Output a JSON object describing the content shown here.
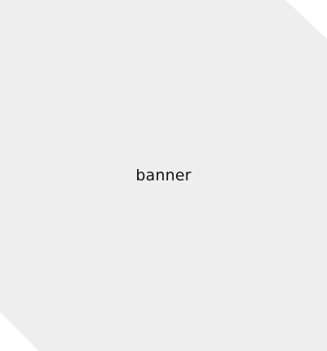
{
  "banner": {
    "label": "banner",
    "background_color": "#eeeeee",
    "text_color": "#111111"
  }
}
